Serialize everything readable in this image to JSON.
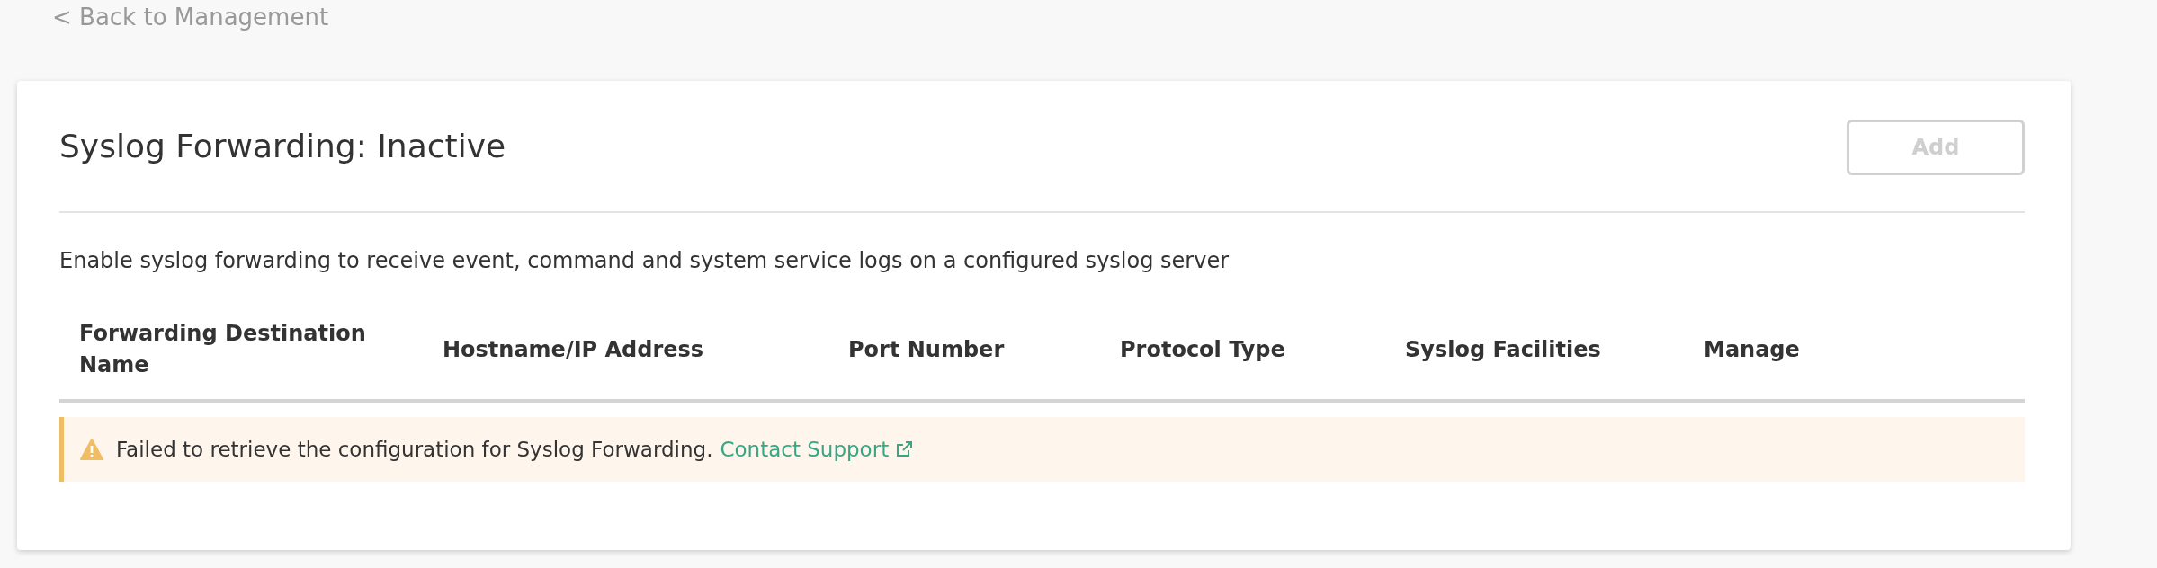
{
  "back_link": "< Back to Management",
  "panel": {
    "title": "Syslog Forwarding: Inactive",
    "add_button": {
      "label": "Add",
      "disabled": true
    },
    "description": "Enable syslog forwarding to receive event, command and system service logs on a configured syslog server",
    "table": {
      "columns": [
        "Forwarding Destination Name",
        "Hostname/IP Address",
        "Port Number",
        "Protocol Type",
        "Syslog Facilities",
        "Manage"
      ]
    },
    "alert": {
      "kind": "warning",
      "message": "Failed to retrieve the configuration for Syslog Forwarding.",
      "link": "Contact Support"
    }
  }
}
